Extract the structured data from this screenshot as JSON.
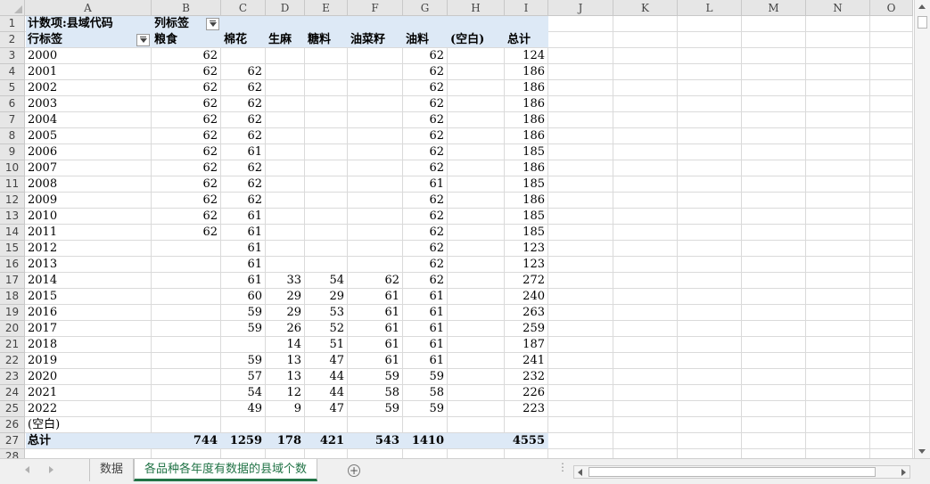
{
  "columns": [
    "A",
    "B",
    "C",
    "D",
    "E",
    "F",
    "G",
    "H",
    "I",
    "J",
    "K",
    "L",
    "M",
    "N",
    "O"
  ],
  "rows": [
    "1",
    "2",
    "3",
    "4",
    "5",
    "6",
    "7",
    "8",
    "9",
    "10",
    "11",
    "12",
    "13",
    "14",
    "15",
    "16",
    "17",
    "18",
    "19",
    "20",
    "21",
    "22",
    "23",
    "24",
    "25",
    "26",
    "27",
    "28"
  ],
  "pivot": {
    "value_field": "计数项:县域代码",
    "col_label": "列标签",
    "row_label": "行标签",
    "headers": [
      "粮食",
      "棉花",
      "生麻",
      "糖料",
      "油菜籽",
      "油料",
      "(空白)",
      "总计"
    ],
    "data": [
      {
        "year": "2000",
        "v": [
          "62",
          "",
          "",
          "",
          "",
          "62",
          "",
          "124"
        ]
      },
      {
        "year": "2001",
        "v": [
          "62",
          "62",
          "",
          "",
          "",
          "62",
          "",
          "186"
        ]
      },
      {
        "year": "2002",
        "v": [
          "62",
          "62",
          "",
          "",
          "",
          "62",
          "",
          "186"
        ]
      },
      {
        "year": "2003",
        "v": [
          "62",
          "62",
          "",
          "",
          "",
          "62",
          "",
          "186"
        ]
      },
      {
        "year": "2004",
        "v": [
          "62",
          "62",
          "",
          "",
          "",
          "62",
          "",
          "186"
        ]
      },
      {
        "year": "2005",
        "v": [
          "62",
          "62",
          "",
          "",
          "",
          "62",
          "",
          "186"
        ]
      },
      {
        "year": "2006",
        "v": [
          "62",
          "61",
          "",
          "",
          "",
          "62",
          "",
          "185"
        ]
      },
      {
        "year": "2007",
        "v": [
          "62",
          "62",
          "",
          "",
          "",
          "62",
          "",
          "186"
        ]
      },
      {
        "year": "2008",
        "v": [
          "62",
          "62",
          "",
          "",
          "",
          "61",
          "",
          "185"
        ]
      },
      {
        "year": "2009",
        "v": [
          "62",
          "62",
          "",
          "",
          "",
          "62",
          "",
          "186"
        ]
      },
      {
        "year": "2010",
        "v": [
          "62",
          "61",
          "",
          "",
          "",
          "62",
          "",
          "185"
        ]
      },
      {
        "year": "2011",
        "v": [
          "62",
          "61",
          "",
          "",
          "",
          "62",
          "",
          "185"
        ]
      },
      {
        "year": "2012",
        "v": [
          "",
          "61",
          "",
          "",
          "",
          "62",
          "",
          "123"
        ]
      },
      {
        "year": "2013",
        "v": [
          "",
          "61",
          "",
          "",
          "",
          "62",
          "",
          "123"
        ]
      },
      {
        "year": "2014",
        "v": [
          "",
          "61",
          "33",
          "54",
          "62",
          "62",
          "",
          "272"
        ]
      },
      {
        "year": "2015",
        "v": [
          "",
          "60",
          "29",
          "29",
          "61",
          "61",
          "",
          "240"
        ]
      },
      {
        "year": "2016",
        "v": [
          "",
          "59",
          "29",
          "53",
          "61",
          "61",
          "",
          "263"
        ]
      },
      {
        "year": "2017",
        "v": [
          "",
          "59",
          "26",
          "52",
          "61",
          "61",
          "",
          "259"
        ]
      },
      {
        "year": "2018",
        "v": [
          "",
          "",
          "14",
          "51",
          "61",
          "61",
          "",
          "187"
        ]
      },
      {
        "year": "2019",
        "v": [
          "",
          "59",
          "13",
          "47",
          "61",
          "61",
          "",
          "241"
        ]
      },
      {
        "year": "2020",
        "v": [
          "",
          "57",
          "13",
          "44",
          "59",
          "59",
          "",
          "232"
        ]
      },
      {
        "year": "2021",
        "v": [
          "",
          "54",
          "12",
          "44",
          "58",
          "58",
          "",
          "226"
        ]
      },
      {
        "year": "2022",
        "v": [
          "",
          "49",
          "9",
          "47",
          "59",
          "59",
          "",
          "223"
        ]
      },
      {
        "year": "(空白)",
        "v": [
          "",
          "",
          "",
          "",
          "",
          "",
          "",
          ""
        ]
      }
    ],
    "total_label": "总计",
    "totals": [
      "744",
      "1259",
      "178",
      "421",
      "543",
      "1410",
      "",
      "4555"
    ]
  },
  "tabs": {
    "sheet1": "数据",
    "sheet2": "各品种各年度有数据的县域个数",
    "add": "+"
  },
  "colors": {
    "pivot_band": "#dde9f6",
    "active_tab": "#217346"
  }
}
